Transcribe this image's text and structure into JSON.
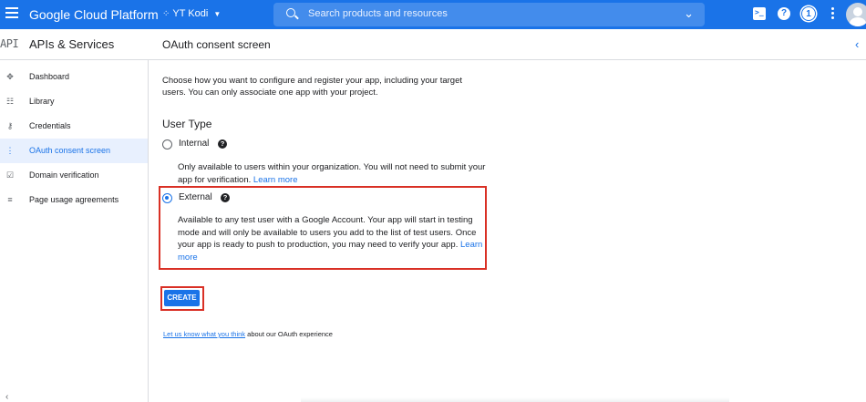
{
  "topbar": {
    "brand": "Google Cloud Platform",
    "project": "YT Kodi",
    "search_placeholder": "Search products and resources",
    "notification_count": "1",
    "help_label": "?"
  },
  "header": {
    "api_logo": "API",
    "section_title": "APIs & Services",
    "page_title": "OAuth consent screen"
  },
  "sidebar": {
    "items": [
      {
        "label": "Dashboard",
        "icon": "dashboard-icon"
      },
      {
        "label": "Library",
        "icon": "library-icon"
      },
      {
        "label": "Credentials",
        "icon": "key-icon"
      },
      {
        "label": "OAuth consent screen",
        "icon": "consent-icon"
      },
      {
        "label": "Domain verification",
        "icon": "checkbox-icon"
      },
      {
        "label": "Page usage agreements",
        "icon": "settings-list-icon"
      }
    ],
    "active_index": 3
  },
  "main": {
    "intro": "Choose how you want to configure and register your app, including your target users. You can only associate one app with your project.",
    "user_type_heading": "User Type",
    "internal": {
      "label": "Internal",
      "description": "Only available to users within your organization. You will not need to submit your app for verification.",
      "link": "Learn more",
      "selected": false
    },
    "external": {
      "label": "External",
      "description": "Available to any test user with a Google Account. Your app will start in testing mode and will only be available to users you add to the list of test users. Once your app is ready to push to production, you may need to verify your app.",
      "link": "Learn more",
      "selected": true
    },
    "create_button": "CREATE",
    "feedback_link": "Let us know what you think",
    "feedback_text": "about our OAuth experience"
  },
  "colors": {
    "primary": "#1a73e8",
    "highlight": "#d93025"
  }
}
